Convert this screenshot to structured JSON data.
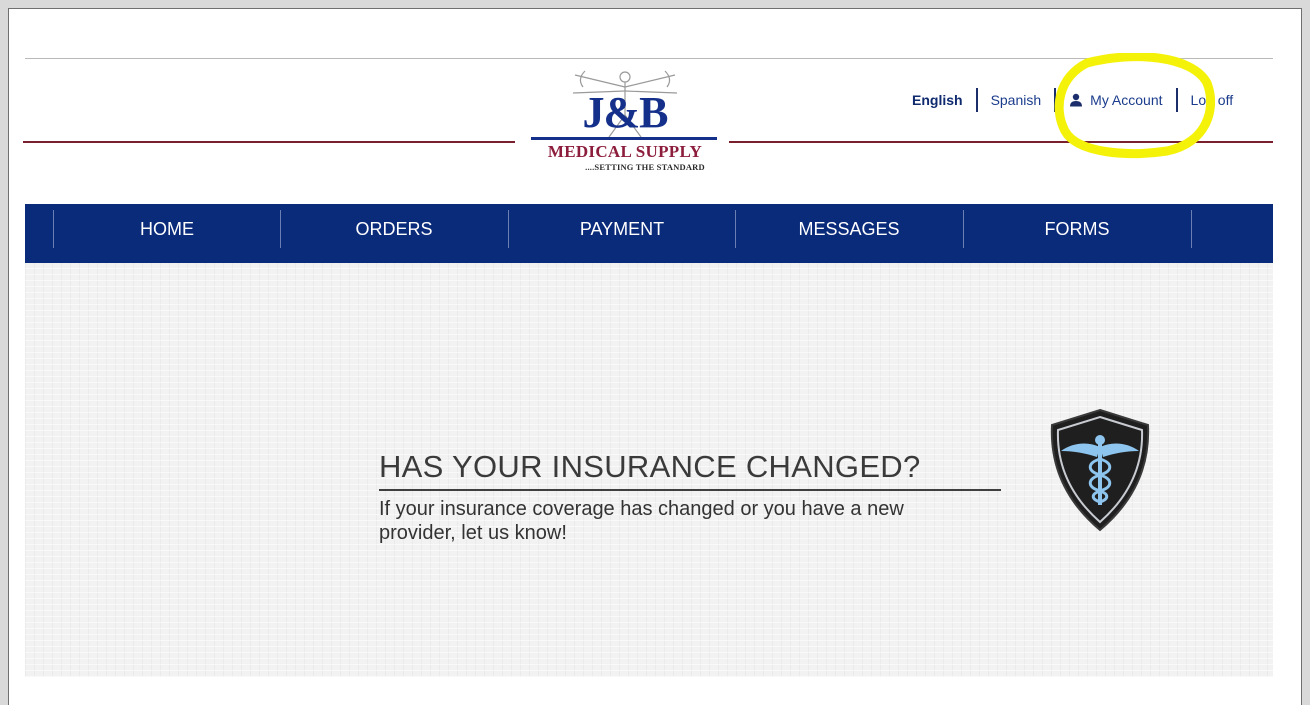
{
  "logo": {
    "name": "J&B",
    "subtitle": "MEDICAL SUPPLY",
    "tagline": "....SETTING THE STANDARD"
  },
  "toplinks": {
    "english": "English",
    "spanish": "Spanish",
    "my_account": "My Account",
    "log_off": "Log off"
  },
  "nav": {
    "items": [
      {
        "label": "HOME"
      },
      {
        "label": "ORDERS"
      },
      {
        "label": "PAYMENT"
      },
      {
        "label": "MESSAGES"
      },
      {
        "label": "FORMS"
      }
    ]
  },
  "hero": {
    "title": "HAS YOUR INSURANCE CHANGED?",
    "text": "If your insurance coverage has changed or you have a new provider, let us know!"
  },
  "colors": {
    "nav_bg": "#0a2a7a",
    "brand_blue": "#14308a",
    "brand_red": "#8c1d3c",
    "highlight": "#f5f20a"
  },
  "icons": [
    "person-icon",
    "caduceus-shield-icon",
    "vitruvian-man-logo"
  ]
}
